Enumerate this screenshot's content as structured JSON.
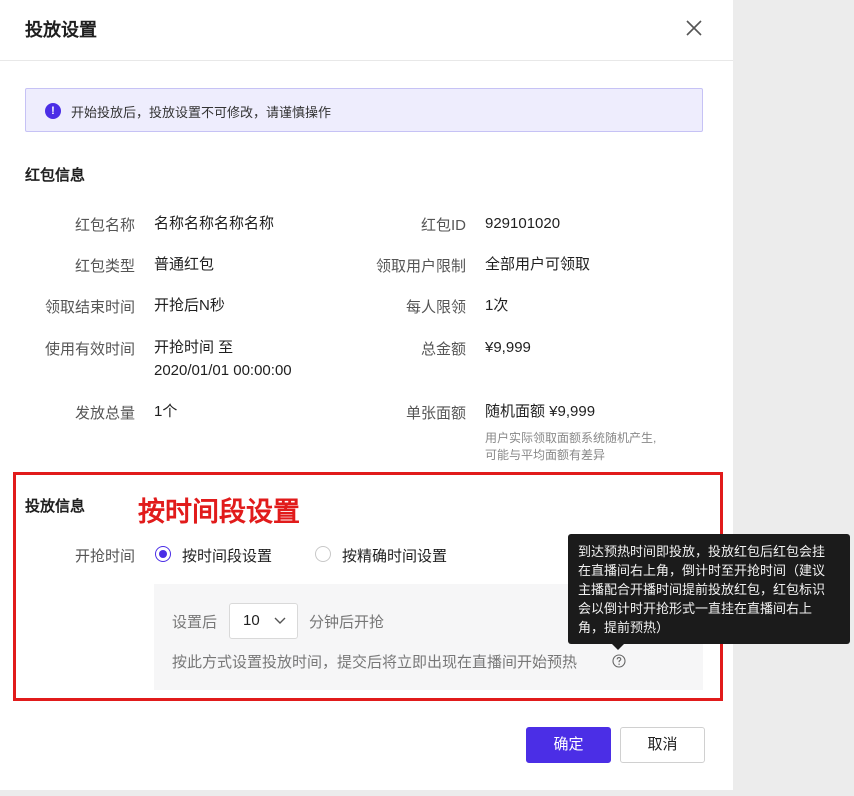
{
  "modal": {
    "title": "投放设置"
  },
  "alert": {
    "text": "开始投放后，投放设置不可修改，请谨慎操作"
  },
  "redpack": {
    "section_title": "红包信息",
    "name": {
      "label": "红包名称",
      "value": "名称名称名称名称"
    },
    "id": {
      "label": "红包ID",
      "value": "929101020"
    },
    "type": {
      "label": "红包类型",
      "value": "普通红包"
    },
    "user_limit": {
      "label": "领取用户限制",
      "value": "全部用户可领取"
    },
    "end_time": {
      "label": "领取结束时间",
      "value": "开抢后N秒"
    },
    "per_person": {
      "label": "每人限领",
      "value": "1次"
    },
    "validity": {
      "label": "使用有效时间",
      "value_line1": "开抢时间 至",
      "value_line2": "2020/01/01 00:00:00"
    },
    "total_amount": {
      "label": "总金额",
      "value": "¥9,999"
    },
    "total_count": {
      "label": "发放总量",
      "value": "1个"
    },
    "unit_amount": {
      "label": "单张面额",
      "value": "随机面额 ¥9,999",
      "hint_line1": "用户实际领取面额系统随机产生,",
      "hint_line2": "可能与平均面额有差异"
    }
  },
  "delivery": {
    "section_title": "投放信息",
    "annotation": "按时间段设置",
    "start_label": "开抢时间",
    "options": [
      {
        "label": "按时间段设置",
        "checked": true
      },
      {
        "label": "按精确时间设置",
        "checked": false
      }
    ],
    "setting_prefix": "设置后",
    "minutes_value": "10",
    "setting_suffix": "分钟后开抢",
    "note": "按此方式设置投放时间，提交后将立即出现在直播间开始预热"
  },
  "tooltip": {
    "lines": [
      "到达预热时间即投放，投放红包后红包会挂",
      "在直播间右上角，倒计时至开抢时间（建议",
      "主播配合开播时间提前投放红包，红包标识",
      "会以倒计时开抢形式一直挂在直播间右上",
      "角，提前预热）"
    ]
  },
  "footer": {
    "confirm_label": "确定",
    "cancel_label": "取消"
  },
  "colors": {
    "primary": "#4b2ee6",
    "annotation_red": "#e11b1b",
    "tooltip_bg": "#1b1b1b"
  },
  "icons": {
    "close": "close-icon",
    "alert": "exclamation-circle-icon",
    "select": "chevron-down-icon",
    "help": "question-circle-icon"
  }
}
